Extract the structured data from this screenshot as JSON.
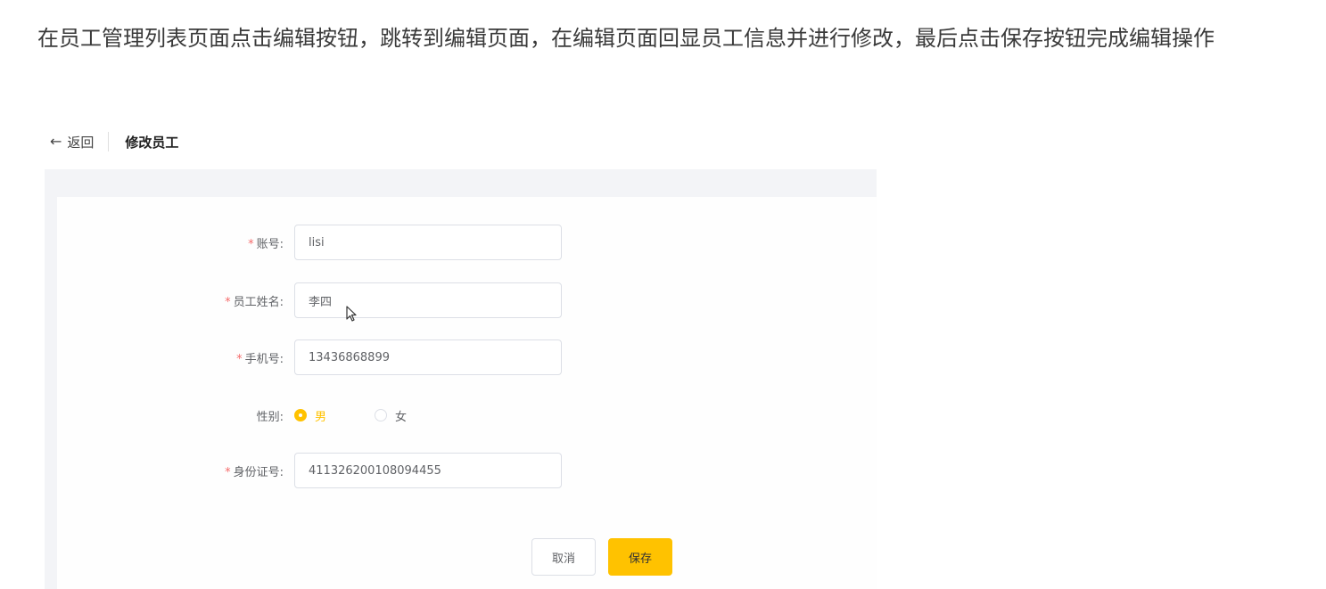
{
  "intro": {
    "text": "在员工管理列表页面点击编辑按钮，跳转到编辑页面，在编辑页面回显员工信息并进行修改，最后点击保存按钮完成编辑操作"
  },
  "header": {
    "back_icon": "arrow-left-icon",
    "back_label": "返回",
    "title": "修改员工"
  },
  "form": {
    "required_mark": "*",
    "account": {
      "label": "账号:",
      "value": "lisi"
    },
    "name": {
      "label": "员工姓名:",
      "value": "李四"
    },
    "phone": {
      "label": "手机号:",
      "value": "13436868899"
    },
    "gender": {
      "label": "性别:",
      "options": [
        "男",
        "女"
      ],
      "selected": "男"
    },
    "id_number": {
      "label": "身份证号:",
      "value": "411326200108094455"
    }
  },
  "buttons": {
    "cancel": "取消",
    "save": "保存"
  },
  "colors": {
    "accent": "#ffc200",
    "required": "#f56c6c",
    "panel_bg": "#f3f4f7"
  }
}
